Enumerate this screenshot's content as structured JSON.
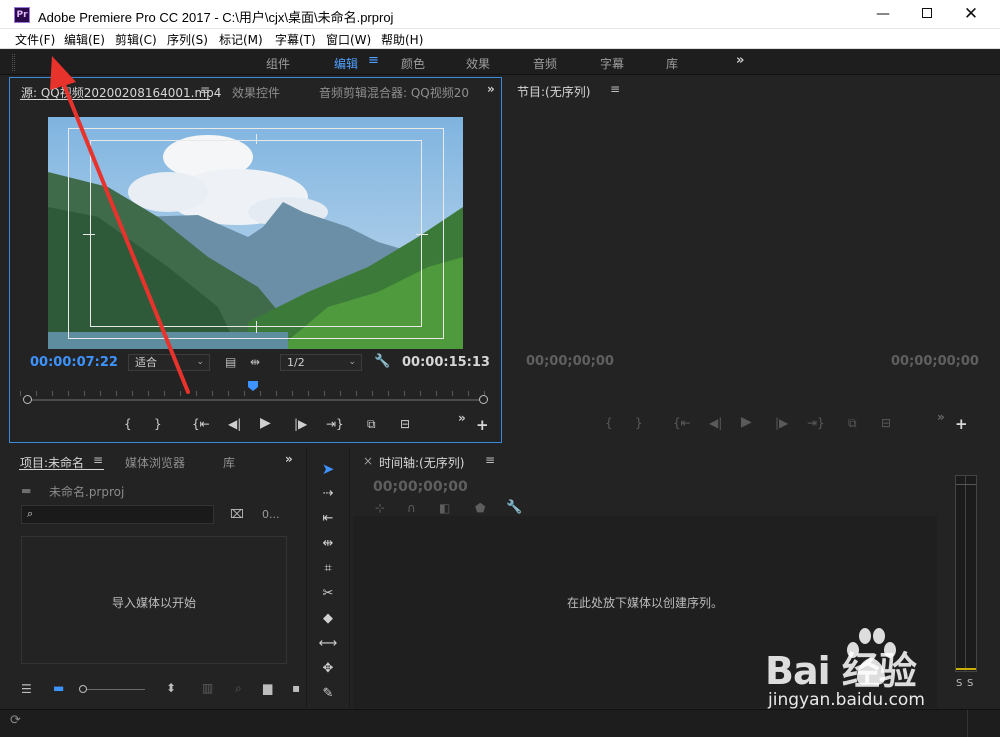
{
  "window": {
    "app_icon_text": "Pr",
    "title": "Adobe Premiere Pro CC 2017 - C:\\用户\\cjx\\桌面\\未命名.prproj",
    "min_glyph": "—",
    "close_glyph": "✕"
  },
  "menu": {
    "items": [
      "文件(F)",
      "编辑(E)",
      "剪辑(C)",
      "序列(S)",
      "标记(M)",
      "字幕(T)",
      "窗口(W)",
      "帮助(H)"
    ]
  },
  "workspace": {
    "tabs": [
      "组件",
      "编辑",
      "颜色",
      "效果",
      "音频",
      "字幕",
      "库"
    ],
    "active": "编辑",
    "more": "»"
  },
  "source_panel": {
    "tabs": [
      "源: QQ视频20200208164001.mp4",
      "效果控件",
      "音频剪辑混合器: QQ视频20"
    ],
    "current_time": "00:00:07:22",
    "fit_select": "适合",
    "resolution_select": "1/2",
    "duration": "00:00:15:13"
  },
  "program_panel": {
    "tab": "节目:(无序列)",
    "current_time": "00;00;00;00",
    "duration": "00;00;00;00"
  },
  "project_panel": {
    "tabs": [
      "项目:未命名",
      "媒体浏览器",
      "库"
    ],
    "project_file": "未命名.prproj",
    "search_placeholder": "",
    "item_count": "0...",
    "drop_text": "导入媒体以开始"
  },
  "timeline_panel": {
    "close": "×",
    "tab": "时间轴:(无序列)",
    "timecode": "00;00;00;00",
    "drop_text": "在此处放下媒体以创建序列。"
  },
  "meter": {
    "labels": [
      "S",
      "S"
    ]
  },
  "watermark": {
    "brand": "Bai   经验",
    "url": "jingyan.baidu.com"
  },
  "colors": {
    "accent": "#3d93ff",
    "annotation_arrow": "#e8332c"
  }
}
